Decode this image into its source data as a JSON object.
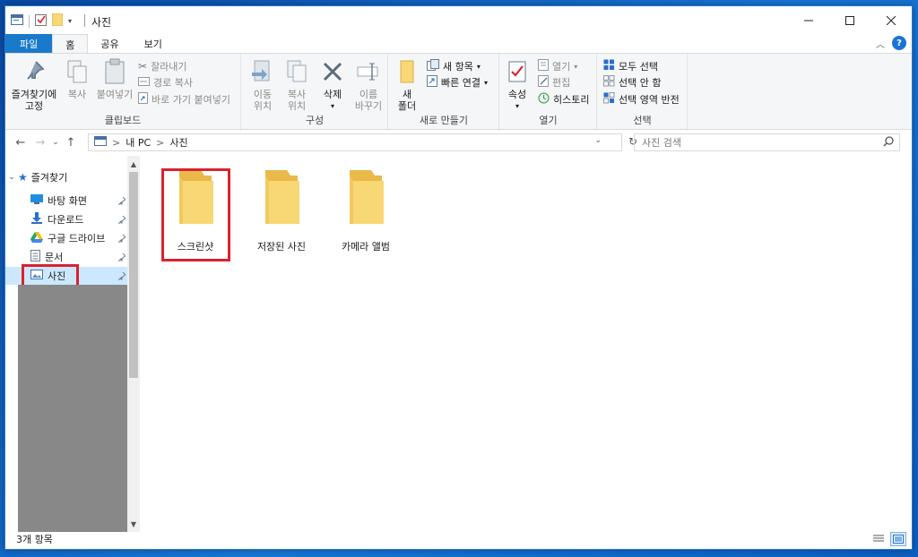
{
  "window": {
    "title": "사진"
  },
  "ribbon_tabs": [
    "파일",
    "홈",
    "공유",
    "보기"
  ],
  "clipboard": {
    "group_label": "클립보드",
    "pin_label_1": "즐겨찾기에",
    "pin_label_2": "고정",
    "copy_label": "복사",
    "paste_label": "붙여넣기",
    "cut_label": "잘라내기",
    "copy_path_label": "경로 복사",
    "paste_shortcut_label": "바로 가기 붙여넣기"
  },
  "organize": {
    "group_label": "구성",
    "move_label_1": "이동",
    "move_label_2": "위치",
    "copyto_label_1": "복사",
    "copyto_label_2": "위치",
    "delete_label": "삭제",
    "rename_label_1": "이름",
    "rename_label_2": "바꾸기"
  },
  "new": {
    "group_label": "새로 만들기",
    "new_folder_label_1": "새",
    "new_folder_label_2": "폴더",
    "new_item_label": "새 항목",
    "easy_access_label": "빠른 연결"
  },
  "open": {
    "group_label": "열기",
    "properties_label": "속성",
    "open_label": "열기",
    "edit_label": "편집",
    "history_label": "히스토리"
  },
  "select": {
    "group_label": "선택",
    "select_all_label": "모두 선택",
    "select_none_label": "선택 안 함",
    "invert_label": "선택 영역 반전"
  },
  "address": {
    "root": "내 PC",
    "current": "사진",
    "separator": ">",
    "search_placeholder": "사진 검색"
  },
  "nav_pane": {
    "quick_access": "즐겨찾기",
    "items": [
      "바탕 화면",
      "다운로드",
      "구글 드라이브",
      "문서",
      "사진"
    ]
  },
  "folders": [
    "스크린샷",
    "저장된 사진",
    "카메라 앨범"
  ],
  "status": {
    "item_count": "3개 항목"
  },
  "colors": {
    "highlight": "#d9232e",
    "accent": "#1979ca",
    "folder": "#f8d775"
  }
}
